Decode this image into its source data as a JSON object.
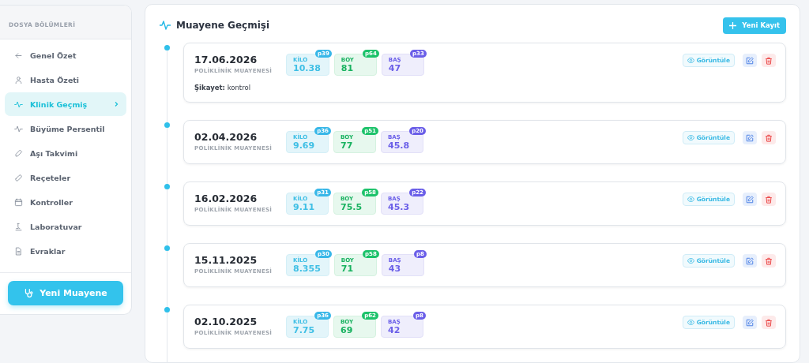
{
  "sidebar": {
    "title": "DOSYA BÖLÜMLERİ",
    "items": [
      {
        "label": "Genel Özet",
        "selected": false
      },
      {
        "label": "Hasta Özeti",
        "selected": false
      },
      {
        "label": "Klinik Geçmiş",
        "selected": true
      },
      {
        "label": "Büyüme Persentil",
        "selected": false
      },
      {
        "label": "Aşı Takvimi",
        "selected": false
      },
      {
        "label": "Reçeteler",
        "selected": false
      },
      {
        "label": "Kontroller",
        "selected": false
      },
      {
        "label": "Laboratuvar",
        "selected": false
      },
      {
        "label": "Evraklar",
        "selected": false
      }
    ],
    "button": "Yeni Muayene"
  },
  "main": {
    "title": "Muayene Geçmişi",
    "add_button": "Yeni Kayıt",
    "visits": [
      {
        "date": "17.06.2026",
        "type": "POLİKLİNİK MUAYENESİ",
        "metrics": [
          {
            "kind": "weight",
            "label": "KİLO",
            "value": "10.38",
            "percentile": "p39"
          },
          {
            "kind": "height",
            "label": "BOY",
            "value": "81",
            "percentile": "p64"
          },
          {
            "kind": "head",
            "label": "BAŞ",
            "value": "47",
            "percentile": "p33"
          }
        ],
        "complaint_label": "Şikayet:",
        "complaint": "kontrol",
        "view_button": "Görüntüle"
      },
      {
        "date": "02.04.2026",
        "type": "POLİKLİNİK MUAYENESİ",
        "metrics": [
          {
            "kind": "weight",
            "label": "KİLO",
            "value": "9.69",
            "percentile": "p36"
          },
          {
            "kind": "height",
            "label": "BOY",
            "value": "77",
            "percentile": "p51"
          },
          {
            "kind": "head",
            "label": "BAŞ",
            "value": "45.8",
            "percentile": "p20"
          }
        ],
        "view_button": "Görüntüle"
      },
      {
        "date": "16.02.2026",
        "type": "POLİKLİNİK MUAYENESİ",
        "metrics": [
          {
            "kind": "weight",
            "label": "KİLO",
            "value": "9.11",
            "percentile": "p31"
          },
          {
            "kind": "height",
            "label": "BOY",
            "value": "75.5",
            "percentile": "p58"
          },
          {
            "kind": "head",
            "label": "BAŞ",
            "value": "45.3",
            "percentile": "p22"
          }
        ],
        "view_button": "Görüntüle"
      },
      {
        "date": "15.11.2025",
        "type": "POLİKLİNİK MUAYENESİ",
        "metrics": [
          {
            "kind": "weight",
            "label": "KİLO",
            "value": "8.355",
            "percentile": "p30"
          },
          {
            "kind": "height",
            "label": "BOY",
            "value": "71",
            "percentile": "p58"
          },
          {
            "kind": "head",
            "label": "BAŞ",
            "value": "43",
            "percentile": "p8"
          }
        ],
        "view_button": "Görüntüle"
      },
      {
        "date": "02.10.2025",
        "type": "POLİKLİNİK MUAYENESİ",
        "metrics": [
          {
            "kind": "weight",
            "label": "KİLO",
            "value": "7.75",
            "percentile": "p36"
          },
          {
            "kind": "height",
            "label": "BOY",
            "value": "69",
            "percentile": "p62"
          },
          {
            "kind": "head",
            "label": "BAŞ",
            "value": "42",
            "percentile": "p8"
          }
        ],
        "view_button": "Görüntüle"
      }
    ]
  }
}
